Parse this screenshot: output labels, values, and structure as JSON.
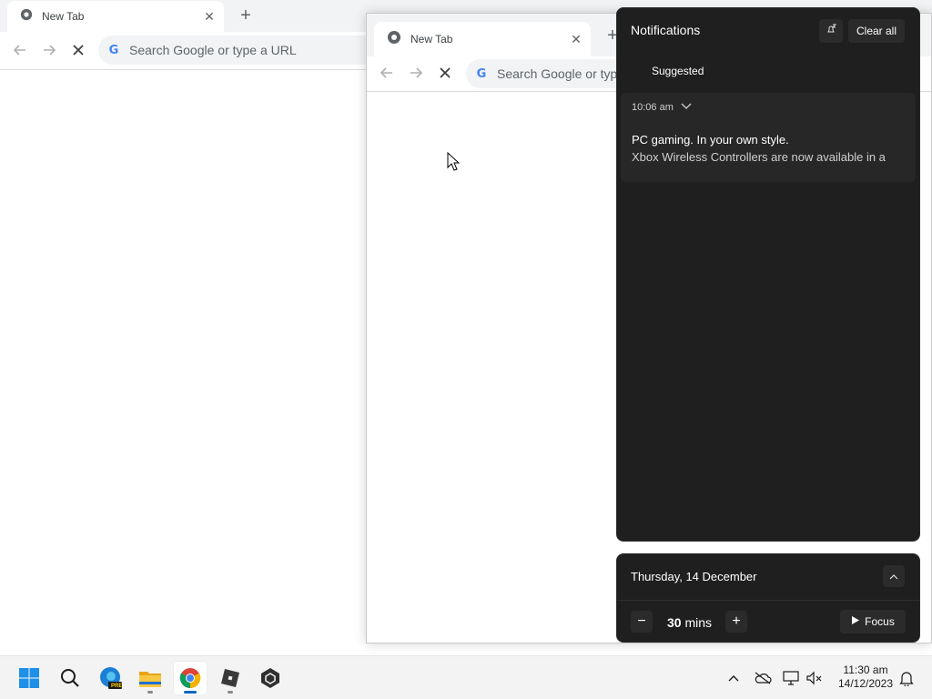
{
  "back_window": {
    "tab_title": "New Tab",
    "new_tab_symbol": "+",
    "omnibox_placeholder": "Search Google or type a URL"
  },
  "front_window": {
    "tab_title": "New Tab",
    "new_tab_symbol": "+",
    "omnibox_placeholder": "Search Google or type a URL"
  },
  "notifications": {
    "title": "Notifications",
    "clear_all_label": "Clear all",
    "suggested_label": "Suggested",
    "items": [
      {
        "time": "10:06 am",
        "title": "PC gaming. In your own style.",
        "body": "Xbox Wireless Controllers are now available in a"
      }
    ]
  },
  "calendar": {
    "date": "Thursday, 14 December",
    "focus_minutes": "30",
    "focus_unit": "mins",
    "focus_label": "Focus",
    "minus_symbol": "−",
    "plus_symbol": "+"
  },
  "taskbar": {
    "apps": [
      "start-icon",
      "search-icon",
      "edge-beta-icon",
      "file-explorer-icon",
      "chrome-icon",
      "roblox-icon",
      "unity-icon"
    ],
    "edge_badge": "PRE",
    "clock_time": "11:30 am",
    "clock_date": "14/12/2023"
  },
  "colors": {
    "accent": "#0067c0",
    "panel_bg": "#1f1f1f",
    "card_bg": "#272727",
    "tabstrip_bg": "#f1f3f4"
  }
}
